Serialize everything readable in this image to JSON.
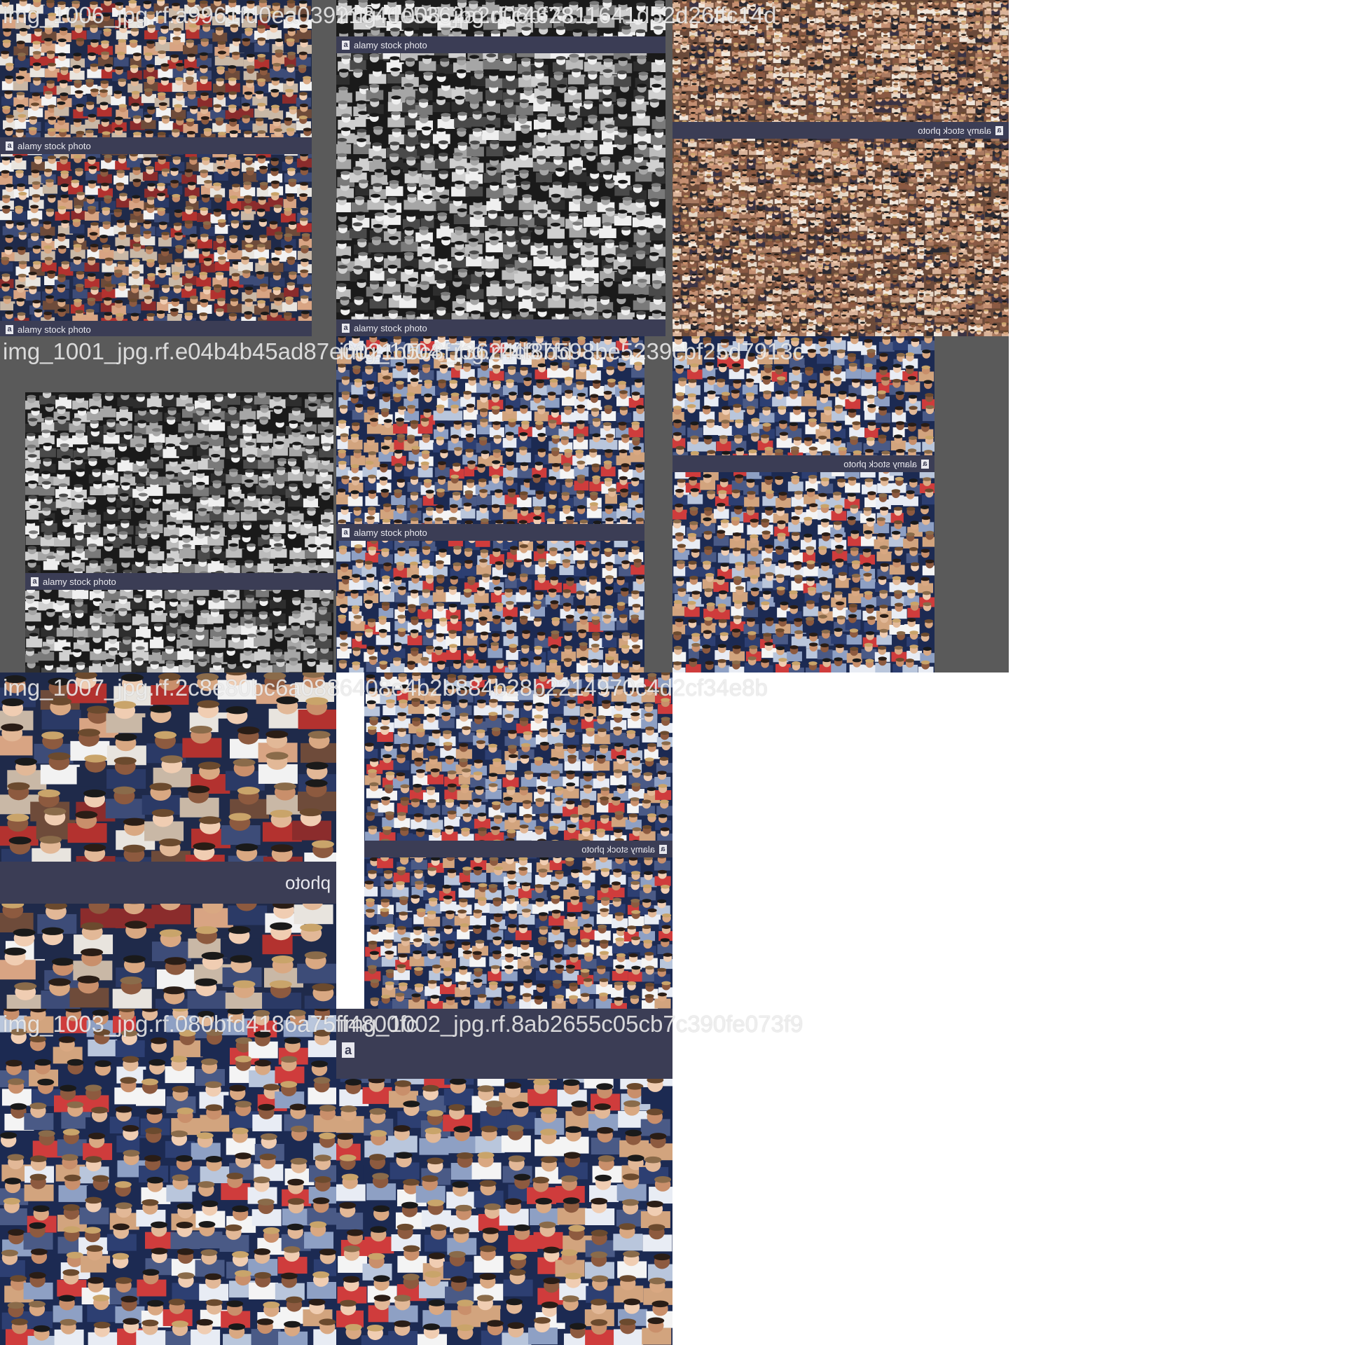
{
  "watermark": {
    "text": "alamy stock photo",
    "short": "photo",
    "logo": "a"
  },
  "tiles": [
    {
      "label": "img_1006_jpg.rf.a9961fd0ea03921840e5362a2d06bf78"
    },
    {
      "label": "img_1005_jpg.rf.c462811641d52d26ffc14d"
    },
    {
      "label": "img_1001_jpg.rf.e04b4b45ad87e0021b5c8f73624d37fd"
    },
    {
      "label": "img_1004_jpg.rf.4f8b598be5239cbf25d7913c"
    },
    {
      "label": "img_1007_jpg.rf.2c8e80bc6a0886408e4b2b884b28b2214970c4d2cf34e8b"
    },
    {
      "label": "img_1003_jpg.rf.080bfd4186a75ff4800fc"
    },
    {
      "label": "img_1002_jpg.rf.8ab2655c05cb7c390fe073f9"
    }
  ],
  "palettes": {
    "warm": [
      "#1f2a4a",
      "#c9b8a6",
      "#8b2c2c",
      "#e8e4de",
      "#2b3a66",
      "#d8a483",
      "#6e4b3a",
      "#f2f2f2",
      "#3d4c78",
      "#b3322f"
    ],
    "mono": [
      "#1a1a1a",
      "#4a4a4a",
      "#7a7a7a",
      "#a6a6a6",
      "#d0d0d0",
      "#efefef",
      "#2e2e2e",
      "#bcbcbc"
    ],
    "dense": [
      "#6b4a3a",
      "#d9b39a",
      "#2a2a33",
      "#e6d8c8",
      "#8a5a44",
      "#c48f72",
      "#3b3344",
      "#f1e7dc",
      "#a97a61"
    ],
    "blue": [
      "#1c2a52",
      "#e8ecf4",
      "#b9c6dc",
      "#cf3c3c",
      "#d2a47e",
      "#2d3f72",
      "#f4f4f4",
      "#8ea0c4",
      "#4a5a86"
    ]
  }
}
